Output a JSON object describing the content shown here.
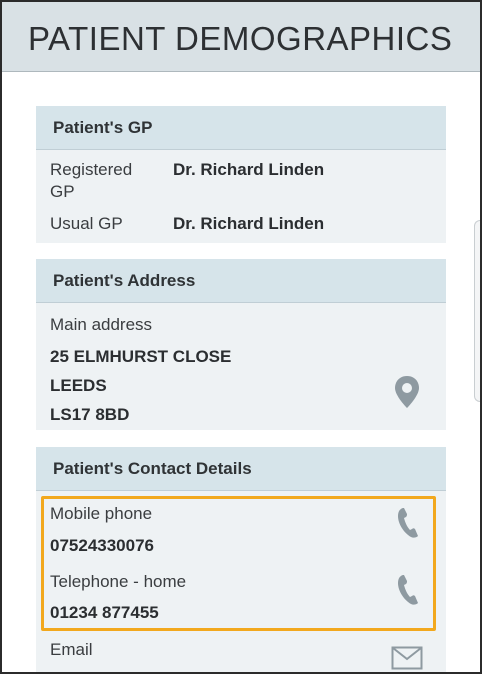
{
  "header": {
    "title": "PATIENT DEMOGRAPHICS"
  },
  "gp": {
    "title": "Patient's GP",
    "registered_label_1": "Registered",
    "registered_label_2": "GP",
    "registered_value": "Dr. Richard Linden",
    "usual_label": "Usual GP",
    "usual_value": "Dr. Richard Linden"
  },
  "address": {
    "title": "Patient's Address",
    "label": "Main address",
    "line1": "25 ELMHURST CLOSE",
    "line2": "LEEDS",
    "line3": "LS17 8BD",
    "icon": "map-pin-icon"
  },
  "contact": {
    "title": "Patient's Contact Details",
    "mobile_label": "Mobile phone",
    "mobile_value": "07524330076",
    "home_label": "Telephone - home",
    "home_value": "01234 877455",
    "email_label": "Email",
    "phone_icon": "phone-icon",
    "email_icon": "envelope-icon"
  },
  "colors": {
    "header_bg": "#d9e1e5",
    "card_bg": "#eef2f4",
    "card_header_bg": "#d6e4ea",
    "icon_gray": "#8e9aa1",
    "highlight": "#f2a81d"
  }
}
